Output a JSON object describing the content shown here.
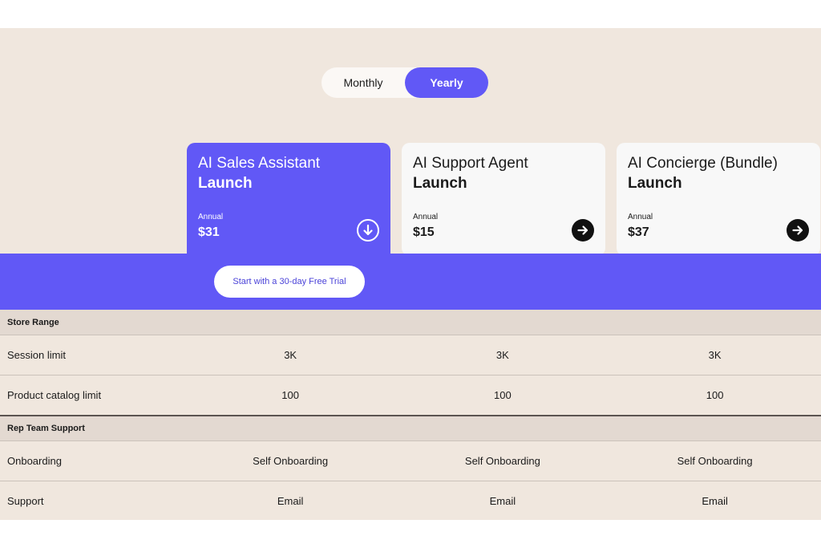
{
  "toggle": {
    "monthly": "Monthly",
    "yearly": "Yearly",
    "active": "yearly"
  },
  "plans": [
    {
      "name": "AI Sales Assistant",
      "tier": "Launch",
      "period": "Annual",
      "price": "$31",
      "icon": "arrow-down-circle-icon"
    },
    {
      "name": "AI Support Agent",
      "tier": "Launch",
      "period": "Annual",
      "price": "$15",
      "icon": "arrow-right-circle-icon"
    },
    {
      "name": "AI Concierge (Bundle)",
      "tier": "Launch",
      "period": "Annual",
      "price": "$37",
      "icon": "arrow-right-circle-icon"
    }
  ],
  "trial_button": "Start with a 30-day Free Trial",
  "sections": [
    {
      "title": "Store Range",
      "rows": [
        {
          "label": "Session limit",
          "values": [
            "3K",
            "3K",
            "3K"
          ]
        },
        {
          "label": "Product catalog limit",
          "values": [
            "100",
            "100",
            "100"
          ]
        }
      ]
    },
    {
      "title": "Rep Team Support",
      "rows": [
        {
          "label": "Onboarding",
          "values": [
            "Self Onboarding",
            "Self Onboarding",
            "Self Onboarding"
          ]
        },
        {
          "label": "Support",
          "values": [
            "Email",
            "Email",
            "Email"
          ]
        }
      ]
    }
  ],
  "colors": {
    "accent": "#6158f6",
    "background": "#f0e7de",
    "section": "#e3d9d1",
    "card": "#f8f8f8"
  }
}
